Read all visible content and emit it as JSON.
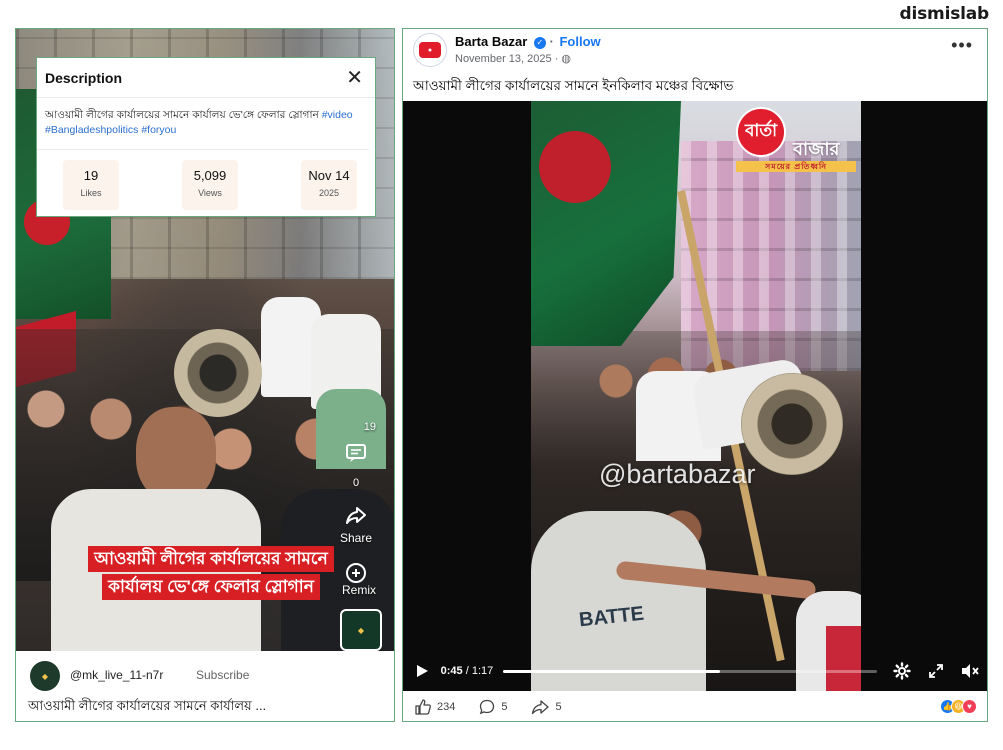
{
  "brand": "dismislab",
  "left_panel": {
    "description": {
      "title": "Description",
      "text": "আওয়ামী লীগের কার্যালয়ের সামনে কার্যালয় ভে'ঙ্গে ফেলার স্লোগান",
      "tags": "#video #Bangladeshpolitics #foryou",
      "stats": [
        {
          "value": "19",
          "label": "Likes"
        },
        {
          "value": "5,099",
          "label": "Views"
        },
        {
          "value": "Nov 14",
          "label": "2025"
        }
      ]
    },
    "side": {
      "like_count": "19",
      "comment_count": "0",
      "share_label": "Share",
      "remix_label": "Remix"
    },
    "overlay": {
      "line1": "আওয়ামী লীগের কার্যালয়ের সামনে",
      "line2": "কার্যালয় ভে'ঙ্গে ফেলার স্লোগান"
    },
    "account": {
      "username": "@mk_live_11-n7r",
      "subscribe": "Subscribe",
      "caption": "আওয়ামী লীগের কার্যালয়ের সামনে কার্যালয় ..."
    }
  },
  "right_panel": {
    "page_name": "Barta Bazar",
    "follow": "Follow",
    "date": "November 13, 2025",
    "post_text": "আওয়ামী লীগের কার্যালয়ের সামনে ইনকিলাব মঞ্চের বিক্ষোভ",
    "video": {
      "logo": "বার্তা",
      "logo_text": "বাজার",
      "logo_sub": "সময়ের প্রতিধ্বনি",
      "watermark": "@bartabazar",
      "shirt_text": "BATTE",
      "time_current": "0:45",
      "time_total": "/ 1:17",
      "progress": 0.58
    },
    "engagement": {
      "likes": "234",
      "comments": "5",
      "shares": "5"
    },
    "colors": {
      "facebook_blue": "#1877f2",
      "like_blue": "#1877f2",
      "haha_yellow": "#f7b125",
      "love_red": "#f33e58"
    }
  }
}
